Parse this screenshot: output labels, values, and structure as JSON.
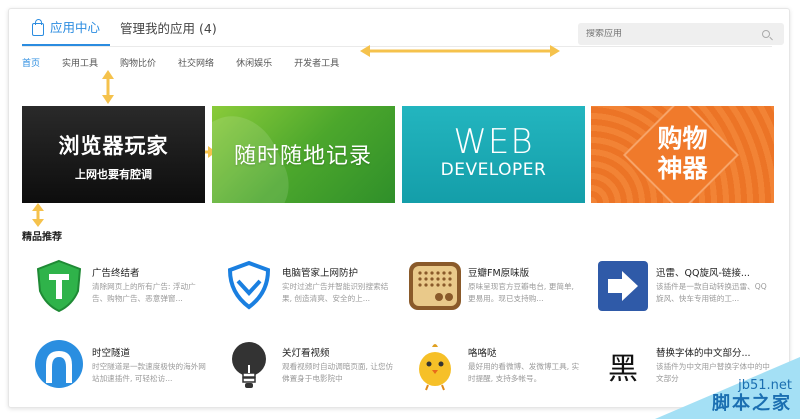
{
  "header": {
    "tab_active": "应用中心",
    "tab_manage": "管理我的应用 (4)"
  },
  "search": {
    "placeholder": "搜索应用"
  },
  "subnav": [
    "首页",
    "实用工具",
    "购物比价",
    "社交网络",
    "休闲娱乐",
    "开发者工具"
  ],
  "banners": {
    "b1_title": "浏览器玩家",
    "b1_sub": "上网也要有腔调",
    "b2_title": "随时随地记录",
    "b3_title": "WEB",
    "b3_sub": "DEVELOPER",
    "b4_title": "购物\n神器"
  },
  "section_title": "精品推荐",
  "apps": [
    {
      "name": "广告终结者",
      "desc": "清除网页上的所有广告: 浮动广告、购物广告、恶意弹窗..."
    },
    {
      "name": "电脑管家上网防护",
      "desc": "实时过滤广告并智能识别搜索结果, 创造清爽、安全的上..."
    },
    {
      "name": "豆瓣FM原味版",
      "desc": "原味呈现官方豆瓣电台, 更简单, 更易用。现已支持购..."
    },
    {
      "name": "迅雷、QQ旋风-链接...",
      "desc": "该插件是一款自动转换迅雷、QQ旋风、快车专用链的工..."
    },
    {
      "name": "时空隧道",
      "desc": "时空隧道是一款速度极快的海外网站加速插件, 可轻松访..."
    },
    {
      "name": "关灯看视频",
      "desc": "观看视频时自动调暗页面, 让您仿佛置身于电影院中"
    },
    {
      "name": "咯咯哒",
      "desc": "最好用的看微博、发微博工具, 实时提醒, 支持多帐号。"
    },
    {
      "name": "替换字体的中文部分...",
      "desc": "该插件为中文用户替换字体中的中文部分"
    }
  ],
  "icons": {
    "hei_char": "黑"
  },
  "watermark": {
    "line1": "jb51.net",
    "line2": "脚本之家"
  },
  "colors": {
    "accent": "#2b8ce0",
    "annotation_arrow": "#f5c24c"
  }
}
